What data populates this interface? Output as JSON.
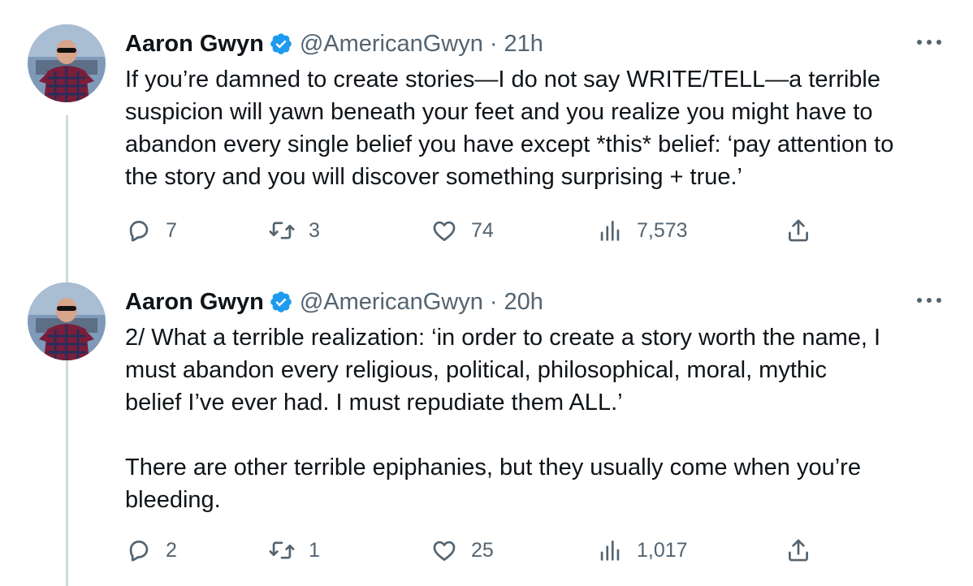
{
  "tweets": [
    {
      "author_name": "Aaron Gwyn",
      "handle": "@AmericanGwyn",
      "separator": "·",
      "time": "21h",
      "text": "If you’re damned to create stories—I do not say WRITE/TELL—a terrible\nsuspicion will yawn beneath your feet and you realize you might have to\nabandon every single belief you have except *this* belief: ‘pay attention to\nthe story and you will discover something surprising + true.’",
      "replies": "7",
      "retweets": "3",
      "likes": "74",
      "views": "7,573"
    },
    {
      "author_name": "Aaron Gwyn",
      "handle": "@AmericanGwyn",
      "separator": "·",
      "time": "20h",
      "text": "2/ What a terrible realization: ‘in order to create a story worth the name, I\nmust abandon every religious, political, philosophical, moral, mythic\nbelief I’ve ever had. I must repudiate them ALL.’\n\nThere are other terrible epiphanies, but they usually come when you’re\nbleeding.",
      "replies": "2",
      "retweets": "1",
      "likes": "25",
      "views": "1,017"
    }
  ],
  "colors": {
    "text": "#0f1419",
    "secondary": "#536471",
    "verified": "#1d9bf0",
    "thread_line": "#cfd9de"
  },
  "icons": [
    "more-icon",
    "verified-icon",
    "reply-icon",
    "retweet-icon",
    "like-icon",
    "views-icon",
    "share-icon"
  ]
}
